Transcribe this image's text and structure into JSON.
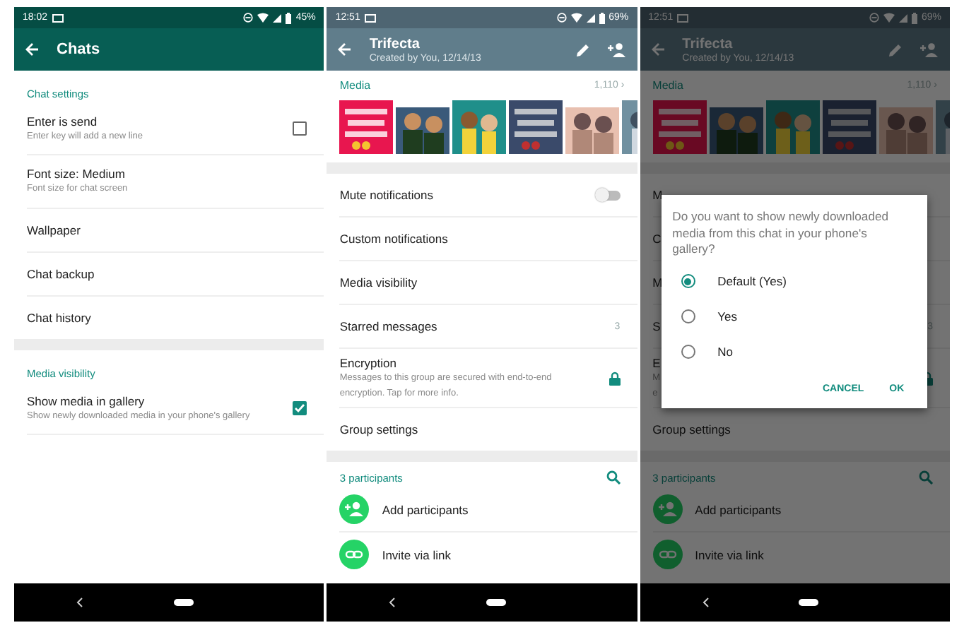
{
  "screens": [
    {
      "kind": "settings",
      "dimmed": false,
      "status_bar": {
        "time": "18:02",
        "battery": "45%"
      },
      "app_bar": {
        "title": "Chats"
      },
      "sections": [
        {
          "header": "Chat settings",
          "items": [
            {
              "kind": "checkbox",
              "title": "Enter is send",
              "subtitle": "Enter key will add a new line",
              "checked": false
            },
            {
              "kind": "plain",
              "title": "Font size: Medium",
              "subtitle": "Font size for chat screen"
            },
            {
              "kind": "plain",
              "title": "Wallpaper"
            },
            {
              "kind": "plain",
              "title": "Chat backup"
            },
            {
              "kind": "plain",
              "title": "Chat history"
            }
          ]
        },
        {
          "header": "Media visibility",
          "items": [
            {
              "kind": "checkbox",
              "title": "Show media in gallery",
              "subtitle": "Show newly downloaded media in your phone's gallery",
              "checked": true
            }
          ]
        }
      ]
    },
    {
      "kind": "group_info",
      "dimmed": false,
      "status_bar": {
        "time": "12:51",
        "battery": "69%"
      },
      "app_bar": {
        "title": "Trifecta",
        "subtitle": "Created by You, 12/14/13"
      },
      "media": {
        "label": "Media",
        "count": "1,110 ›"
      },
      "rows": [
        {
          "kind": "toggle",
          "title": "Mute notifications",
          "on": false
        },
        {
          "kind": "plain",
          "title": "Custom notifications"
        },
        {
          "kind": "plain",
          "title": "Media visibility"
        },
        {
          "kind": "count",
          "title": "Starred messages",
          "count": "3"
        },
        {
          "kind": "lock",
          "title": "Encryption",
          "subtitle_lines": [
            "Messages to this group are secured with end-to-end",
            "encryption. Tap for more info."
          ]
        },
        {
          "kind": "plain",
          "title": "Group settings"
        }
      ],
      "participants": {
        "header": "3 participants",
        "actions": [
          {
            "kind": "add",
            "label": "Add participants"
          },
          {
            "kind": "link",
            "label": "Invite via link"
          }
        ]
      }
    },
    {
      "kind": "group_info",
      "dimmed": true,
      "status_bar": {
        "time": "12:51",
        "battery": "69%"
      },
      "app_bar": {
        "title": "Trifecta",
        "subtitle": "Created by You, 12/14/13"
      },
      "media": {
        "label": "Media",
        "count": "1,110 ›"
      },
      "rows": [
        {
          "kind": "plain",
          "title": "M"
        },
        {
          "kind": "plain",
          "title": "C"
        },
        {
          "kind": "plain",
          "title": "M"
        },
        {
          "kind": "count",
          "title": "S",
          "count": "3"
        },
        {
          "kind": "lock",
          "title": "E",
          "subtitle_lines": [
            "M",
            "e"
          ]
        },
        {
          "kind": "plain",
          "title": "Group settings"
        }
      ],
      "participants": {
        "header": "3 participants",
        "actions": [
          {
            "kind": "add",
            "label": "Add participants"
          },
          {
            "kind": "link",
            "label": "Invite via link"
          }
        ]
      },
      "dialog": {
        "question": "Do you want to show newly downloaded media from this chat in your phone's gallery?",
        "options": [
          {
            "label": "Default (Yes)",
            "selected": true
          },
          {
            "label": "Yes",
            "selected": false
          },
          {
            "label": "No",
            "selected": false
          }
        ],
        "buttons": [
          "CANCEL",
          "OK"
        ]
      }
    }
  ]
}
